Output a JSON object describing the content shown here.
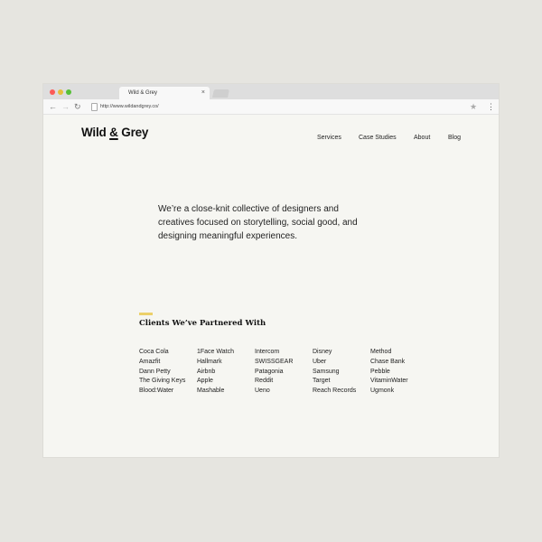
{
  "browser": {
    "tab_title": "Wild & Grey",
    "tab_close": "×",
    "url": "http://www.wildandgrey.co/",
    "icons": [
      "back-arrow-icon",
      "forward-arrow-icon",
      "reload-icon",
      "page-icon",
      "star-icon",
      "menu-dots-icon"
    ]
  },
  "site": {
    "logo_prefix": "Wild",
    "logo_amp": "&",
    "logo_suffix": "Grey",
    "nav": [
      "Services",
      "Case Studies",
      "About",
      "Blog"
    ],
    "hero_text": "We’re a close-knit collective of designers and creatives focused on storytelling, social good, and designing meaningful experiences.",
    "accent_color": "#ecd06a",
    "clients_title": "Clients We’ve Partnered With",
    "clients": [
      [
        "Coca Cola",
        "Amazfit",
        "Dann Petty",
        "The Giving Keys",
        "Blood:Water"
      ],
      [
        "1Face Watch",
        "Hallmark",
        "Airbnb",
        "Apple",
        "Mashable"
      ],
      [
        "Intercom",
        "SWISSGEAR",
        "Patagonia",
        "Reddit",
        "Ueno"
      ],
      [
        "Disney",
        "Uber",
        "Samsung",
        "Target",
        "Reach Records"
      ],
      [
        "Method",
        "Chase Bank",
        "Pebble",
        "VitaminWater",
        "Ugmonk"
      ]
    ]
  }
}
